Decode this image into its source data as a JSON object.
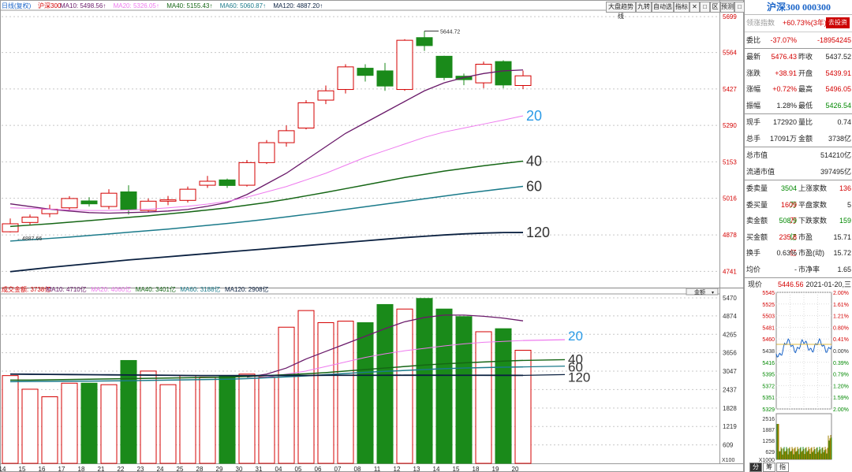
{
  "toolbar": {
    "period_label": "日线(复权)",
    "ma_price": [
      {
        "text": "沪深300",
        "color": "#d40000"
      },
      {
        "text": "MA10: 5498.56↑",
        "color": "#6a1a6a"
      },
      {
        "text": "MA20: 5326.05↑",
        "color": "#ee7aee"
      },
      {
        "text": "MA40: 5155.43↑",
        "color": "#156615"
      },
      {
        "text": "MA60: 5060.87↑",
        "color": "#1a7a8a"
      },
      {
        "text": "MA120: 4887.20↑",
        "color": "#0a2040"
      }
    ],
    "buttons": [
      "大盘趋势线",
      "九转",
      "自动选",
      "指标",
      "✕",
      "□",
      "区",
      "预测",
      "□"
    ]
  },
  "volume_bar": {
    "items": [
      {
        "text": "成交金额: 3738亿",
        "color": "#d40000"
      },
      {
        "text": "MA10: 4710亿",
        "color": "#6a1a6a"
      },
      {
        "text": "MA20: 4060亿",
        "color": "#ee7aee"
      },
      {
        "text": "MA40: 3401亿",
        "color": "#156615"
      },
      {
        "text": "MA60: 3188亿",
        "color": "#1a7a8a"
      },
      {
        "text": "MA120: 2908亿",
        "color": "#0a2040"
      }
    ],
    "dropdown": "金额",
    "unit": "X100"
  },
  "price_axis": [
    "5699",
    "5564",
    "5427",
    "5290",
    "5153",
    "5016",
    "4878",
    "4741"
  ],
  "volume_axis": [
    "5470",
    "4874",
    "4265",
    "3656",
    "3047",
    "2437",
    "1828",
    "1219",
    "609"
  ],
  "date_labels": [
    "14",
    "15",
    "16",
    "17",
    "18",
    "21",
    "22",
    "23",
    "24",
    "25",
    "28",
    "29",
    "30",
    "31",
    "04",
    "05",
    "06",
    "07",
    "08",
    "11",
    "12",
    "13",
    "14",
    "15",
    "18",
    "19",
    "20"
  ],
  "labels": {
    "ma": [
      {
        "text": "20",
        "color": "#2a9ae6"
      },
      {
        "text": "40",
        "color": "#333333"
      },
      {
        "text": "60",
        "color": "#333333"
      },
      {
        "text": "120",
        "color": "#333333"
      }
    ],
    "vol_ma": [
      {
        "text": "20",
        "color": "#2a9ae6"
      },
      {
        "text": "40",
        "color": "#333333"
      },
      {
        "text": "60",
        "color": "#333333"
      },
      {
        "text": "120",
        "color": "#333333"
      }
    ],
    "high_mark": "5644.72",
    "low_mark": "4887.66"
  },
  "colors": {
    "up": "#d40000",
    "down": "#1a8a1a",
    "ma10": "#6a1a6a",
    "ma20": "#ee7aee",
    "ma40": "#156615",
    "ma60": "#1a7a8a",
    "ma120": "#0a2040",
    "ma20_label": "#2a9ae6"
  },
  "chart_data": {
    "type": "candlestick",
    "categories": [
      "14",
      "15",
      "16",
      "17",
      "18",
      "21",
      "22",
      "23",
      "24",
      "25",
      "28",
      "29",
      "30",
      "31",
      "04",
      "05",
      "06",
      "07",
      "08",
      "11",
      "12",
      "13",
      "14",
      "15",
      "18",
      "19",
      "20"
    ],
    "ohlc": [
      [
        4890,
        4920,
        4887.66,
        4940
      ],
      [
        4925,
        4945,
        4915,
        4955
      ],
      [
        4958,
        4975,
        4945,
        4992
      ],
      [
        4980,
        5015,
        4970,
        5024
      ],
      [
        5006,
        4995,
        4985,
        5020
      ],
      [
        4985,
        5035,
        4975,
        5050
      ],
      [
        5040,
        4973,
        4955,
        5065
      ],
      [
        4970,
        5005,
        4965,
        5015
      ],
      [
        5005,
        5010,
        4990,
        5025
      ],
      [
        5008,
        5050,
        5000,
        5060
      ],
      [
        5065,
        5080,
        5055,
        5100
      ],
      [
        5085,
        5064,
        5055,
        5090
      ],
      [
        5065,
        5150,
        5060,
        5160
      ],
      [
        5150,
        5225,
        5145,
        5235
      ],
      [
        5225,
        5270,
        5210,
        5290
      ],
      [
        5280,
        5375,
        5275,
        5385
      ],
      [
        5385,
        5420,
        5370,
        5440
      ],
      [
        5425,
        5510,
        5410,
        5520
      ],
      [
        5505,
        5478,
        5455,
        5520
      ],
      [
        5495,
        5438,
        5420,
        5525
      ],
      [
        5425,
        5610,
        5420,
        5614
      ],
      [
        5620,
        5590,
        5570,
        5644.72
      ],
      [
        5550,
        5470,
        5460,
        5552
      ],
      [
        5475,
        5462,
        5441,
        5485
      ],
      [
        5450,
        5520,
        5430,
        5530
      ],
      [
        5530,
        5442,
        5430,
        5535
      ],
      [
        5440,
        5476.43,
        5426.54,
        5496.05
      ]
    ],
    "ma": [
      {
        "name": "MA10",
        "values": [
          4995,
          4985,
          4975,
          4968,
          4962,
          4960,
          4962,
          4964,
          4968,
          4974,
          4986,
          5000,
          5030,
          5070,
          5110,
          5160,
          5210,
          5260,
          5300,
          5340,
          5380,
          5420,
          5450,
          5470,
          5485,
          5495,
          5498.56
        ]
      },
      {
        "name": "MA20",
        "values": [
          4980,
          4978,
          4975,
          4972,
          4970,
          4970,
          4972,
          4975,
          4980,
          4986,
          4994,
          5004,
          5020,
          5040,
          5060,
          5085,
          5110,
          5140,
          5170,
          5195,
          5220,
          5245,
          5265,
          5280,
          5295,
          5310,
          5326.05
        ]
      },
      {
        "name": "MA40",
        "values": [
          4910,
          4915,
          4920,
          4926,
          4932,
          4938,
          4944,
          4950,
          4957,
          4964,
          4972,
          4980,
          4990,
          5000,
          5012,
          5025,
          5038,
          5052,
          5066,
          5080,
          5094,
          5106,
          5118,
          5128,
          5138,
          5147,
          5155.43
        ]
      },
      {
        "name": "MA60",
        "values": [
          4855,
          4860,
          4865,
          4870,
          4876,
          4882,
          4888,
          4894,
          4900,
          4907,
          4914,
          4921,
          4929,
          4937,
          4946,
          4955,
          4964,
          4974,
          4984,
          4994,
          5004,
          5014,
          5024,
          5034,
          5043,
          5052,
          5060.87
        ]
      },
      {
        "name": "MA120",
        "values": [
          4740,
          4748,
          4756,
          4763,
          4770,
          4777,
          4784,
          4790,
          4796,
          4802,
          4808,
          4814,
          4820,
          4826,
          4832,
          4838,
          4844,
          4850,
          4856,
          4862,
          4868,
          4873,
          4878,
          4882,
          4885,
          4887,
          4887.2
        ]
      }
    ],
    "volume": [
      2900,
      2450,
      2200,
      2650,
      2650,
      2600,
      3400,
      3050,
      2600,
      2900,
      2850,
      2900,
      2950,
      2850,
      4500,
      5050,
      4650,
      4700,
      4650,
      5250,
      5100,
      5450,
      5100,
      4850,
      4350,
      4450,
      3738
    ],
    "volume_ma": [
      {
        "name": "MA10",
        "values": [
          null,
          null,
          null,
          null,
          null,
          null,
          null,
          null,
          null,
          null,
          null,
          null,
          2850,
          2950,
          3150,
          3450,
          3700,
          3950,
          4200,
          4450,
          4680,
          4820,
          4900,
          4900,
          4860,
          4800,
          4710
        ]
      },
      {
        "name": "MA20",
        "values": [
          null,
          null,
          null,
          null,
          null,
          null,
          null,
          null,
          null,
          null,
          null,
          null,
          2800,
          2850,
          2950,
          3050,
          3200,
          3350,
          3500,
          3620,
          3720,
          3800,
          3880,
          3950,
          4000,
          4030,
          4060
        ]
      },
      {
        "name": "MA40",
        "values": [
          2750,
          2750,
          2760,
          2770,
          2780,
          2790,
          2800,
          2810,
          2820,
          2830,
          2840,
          2850,
          2870,
          2900,
          2930,
          2960,
          3000,
          3050,
          3100,
          3150,
          3200,
          3250,
          3290,
          3320,
          3350,
          3380,
          3401
        ]
      },
      {
        "name": "MA60",
        "values": [
          2700,
          2705,
          2710,
          2715,
          2720,
          2725,
          2730,
          2740,
          2750,
          2760,
          2770,
          2780,
          2800,
          2830,
          2860,
          2890,
          2930,
          2970,
          3010,
          3040,
          3070,
          3100,
          3130,
          3150,
          3165,
          3178,
          3188
        ]
      },
      {
        "name": "MA120",
        "values": [
          2950,
          2945,
          2940,
          2935,
          2930,
          2925,
          2920,
          2915,
          2910,
          2905,
          2900,
          2900,
          2900,
          2900,
          2905,
          2905,
          2910,
          2910,
          2910,
          2910,
          2912,
          2912,
          2910,
          2910,
          2910,
          2909,
          2908
        ]
      }
    ],
    "price_range": [
      4680,
      5720
    ],
    "volume_range": [
      0,
      5600
    ],
    "grid": true
  },
  "panel": {
    "title": "沪深300 000300",
    "lead": {
      "label": "领涨指数",
      "value": "+60.73%(3年)",
      "btn": "去投资"
    },
    "rows": [
      {
        "l1": "委比",
        "v1": "-37.07%",
        "c1": "red",
        "l2": "",
        "v2": "-18954245",
        "c2": "red",
        "sep": false
      },
      {
        "l1": "最新",
        "v1": "5476.43",
        "c1": "red",
        "l2": "昨收",
        "v2": "5437.52",
        "c2": "",
        "sep": true
      },
      {
        "l1": "涨跌",
        "v1": "+38.91",
        "c1": "red",
        "l2": "开盘",
        "v2": "5439.91",
        "c2": "red",
        "sep": false
      },
      {
        "l1": "涨幅",
        "v1": "+0.72%",
        "c1": "red",
        "l2": "最高",
        "v2": "5496.05",
        "c2": "red",
        "sep": false
      },
      {
        "l1": "振幅",
        "v1": "1.28%",
        "c1": "",
        "l2": "最低",
        "v2": "5426.54",
        "c2": "green",
        "sep": false
      },
      {
        "l1": "现手",
        "v1": "172920",
        "c1": "",
        "l2": "量比",
        "v2": "0.74",
        "c2": "",
        "sep": true
      },
      {
        "l1": "总手",
        "v1": "17091万",
        "c1": "",
        "l2": "金额",
        "v2": "3738亿",
        "c2": "",
        "sep": false
      },
      {
        "l1": "总市值",
        "v1": "",
        "c1": "",
        "l2": "",
        "v2": "514210亿",
        "c2": "",
        "sep": true
      },
      {
        "l1": "流通市值",
        "v1": "",
        "c1": "",
        "l2": "",
        "v2": "397495亿",
        "c2": "",
        "sep": false
      },
      {
        "l1": "委卖量",
        "v1": "3504万",
        "c1": "green",
        "l2": "上涨家数",
        "v2": "136",
        "c2": "red",
        "sep": true
      },
      {
        "l1": "委买量",
        "v1": "1609万",
        "c1": "red",
        "l2": "平盘家数",
        "v2": "5",
        "c2": "",
        "sep": false
      },
      {
        "l1": "卖金额",
        "v1": "508.9亿",
        "c1": "green",
        "l2": "下跌家数",
        "v2": "159",
        "c2": "green",
        "sep": false
      },
      {
        "l1": "买金额",
        "v1": "235.8亿",
        "c1": "red",
        "l2": "市盈",
        "v2": "15.71",
        "c2": "",
        "sep": false
      },
      {
        "l1": "换手",
        "v1": "0.63%",
        "c1": "",
        "l2": "市盈(动)",
        "v2": "15.72",
        "c2": "",
        "sep": false
      },
      {
        "l1": "均价",
        "v1": "-",
        "c1": "",
        "l2": "市净率",
        "v2": "1.65",
        "c2": "",
        "sep": false
      }
    ],
    "now": {
      "label": "现价",
      "price": "5446.56",
      "date": "2021-01-20,三"
    },
    "mini_left": [
      "5545",
      "5525",
      "5503",
      "5481",
      "5460",
      "5438",
      "5416",
      "5395",
      "5372",
      "5351",
      "5329"
    ],
    "mini_right": [
      "2.00%",
      "1.61%",
      "1.21%",
      "0.80%",
      "0.41%",
      "0.00%",
      "0.39%",
      "0.79%",
      "1.20%",
      "1.59%",
      "2.00%"
    ],
    "mini_vol": [
      "2516",
      "1887",
      "1258",
      "629"
    ],
    "mini_unit": "X1000",
    "tabs": [
      "分",
      "筹",
      "指"
    ]
  }
}
